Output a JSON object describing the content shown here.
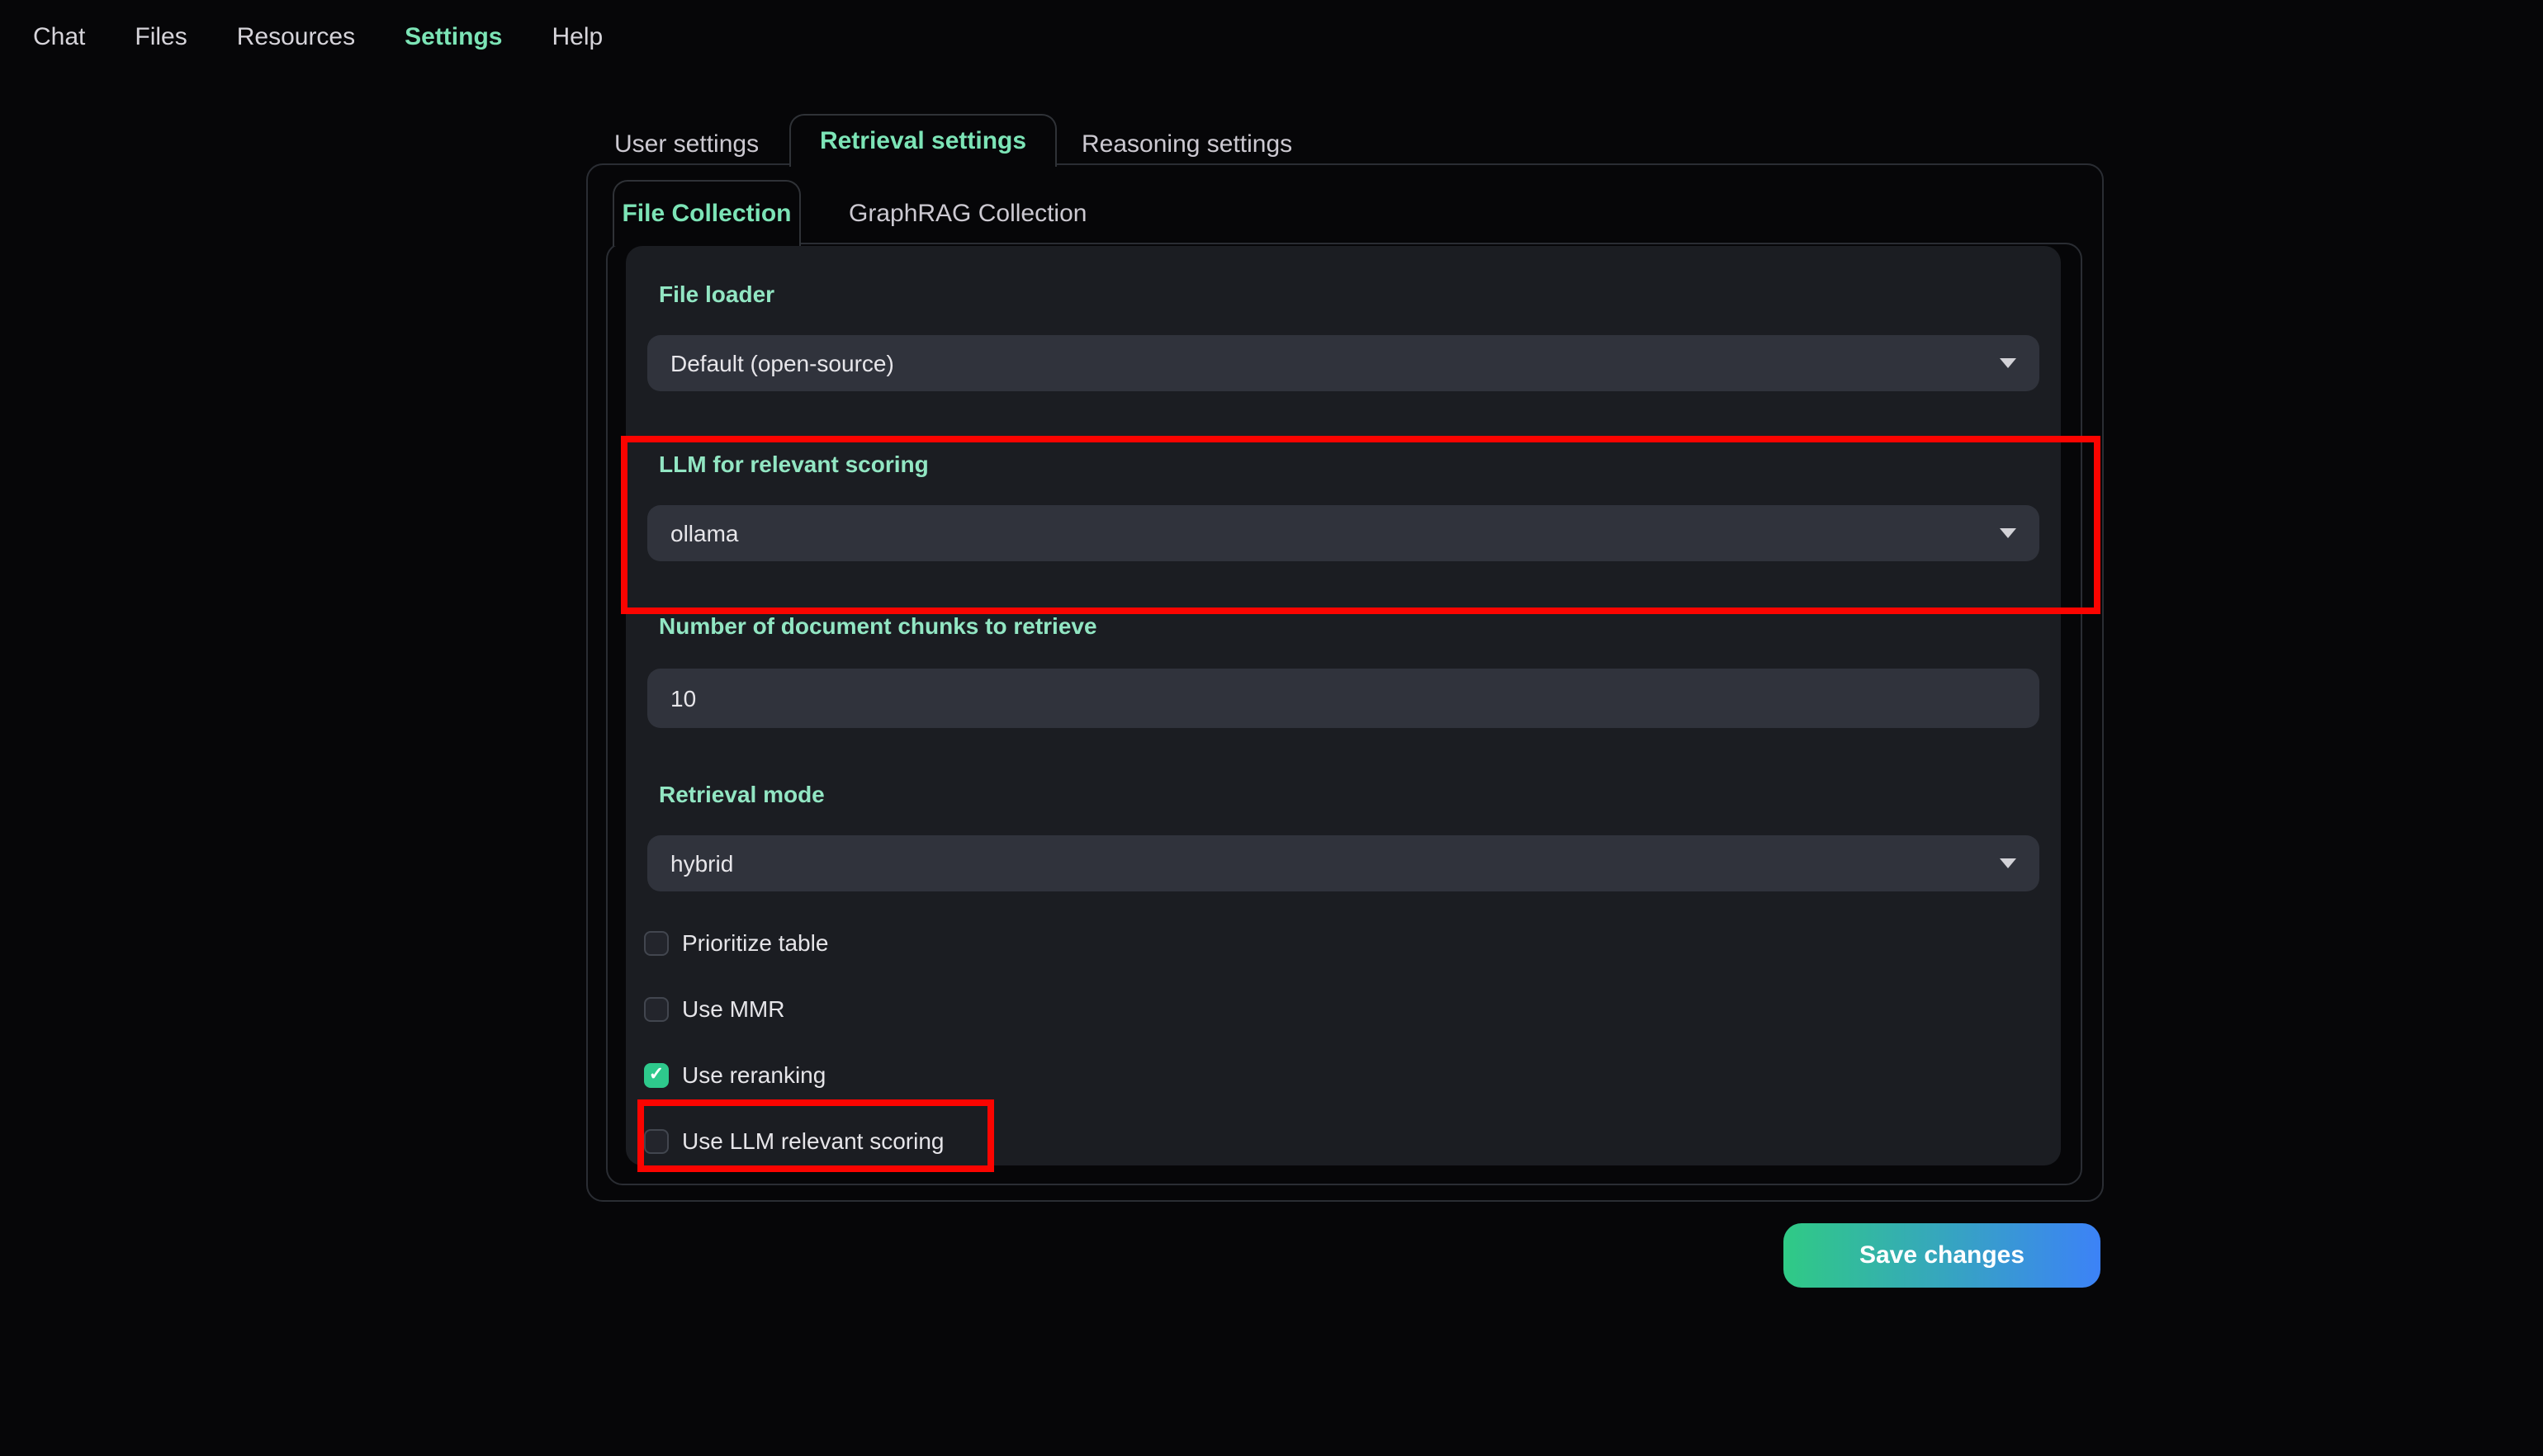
{
  "nav": {
    "items": [
      {
        "label": "Chat",
        "active": false
      },
      {
        "label": "Files",
        "active": false
      },
      {
        "label": "Resources",
        "active": false
      },
      {
        "label": "Settings",
        "active": true
      },
      {
        "label": "Help",
        "active": false
      }
    ]
  },
  "tabs": {
    "items": [
      {
        "label": "User settings",
        "active": false
      },
      {
        "label": "Retrieval settings",
        "active": true
      },
      {
        "label": "Reasoning settings",
        "active": false
      }
    ]
  },
  "subtabs": {
    "items": [
      {
        "label": "File Collection",
        "active": true
      },
      {
        "label": "GraphRAG Collection",
        "active": false
      }
    ]
  },
  "form": {
    "file_loader": {
      "label": "File loader",
      "value": "Default (open-source)"
    },
    "llm_scoring": {
      "label": "LLM for relevant scoring",
      "value": "ollama"
    },
    "chunks": {
      "label": "Number of document chunks to retrieve",
      "value": "10"
    },
    "retrieval_mode": {
      "label": "Retrieval mode",
      "value": "hybrid"
    },
    "checkboxes": [
      {
        "label": "Prioritize table",
        "checked": false
      },
      {
        "label": "Use MMR",
        "checked": false
      },
      {
        "label": "Use reranking",
        "checked": true
      },
      {
        "label": "Use LLM relevant scoring",
        "checked": false
      }
    ]
  },
  "save_button": {
    "label": "Save changes"
  },
  "annotations": {
    "color": "#fb0400",
    "boxes": [
      "llm-for-relevant-scoring-field",
      "use-llm-relevant-scoring-checkbox"
    ]
  },
  "colors": {
    "page_background": "#060608",
    "card_background": "#1b1d22",
    "input_background": "#30333c",
    "accent_mint": "#7ce4b6",
    "label_green": "#92e6c3",
    "checkbox_checked": "#2ec98c",
    "save_gradient_start": "#30ca85",
    "save_gradient_end": "#3c82f7",
    "annotation_red": "#fb0400"
  }
}
